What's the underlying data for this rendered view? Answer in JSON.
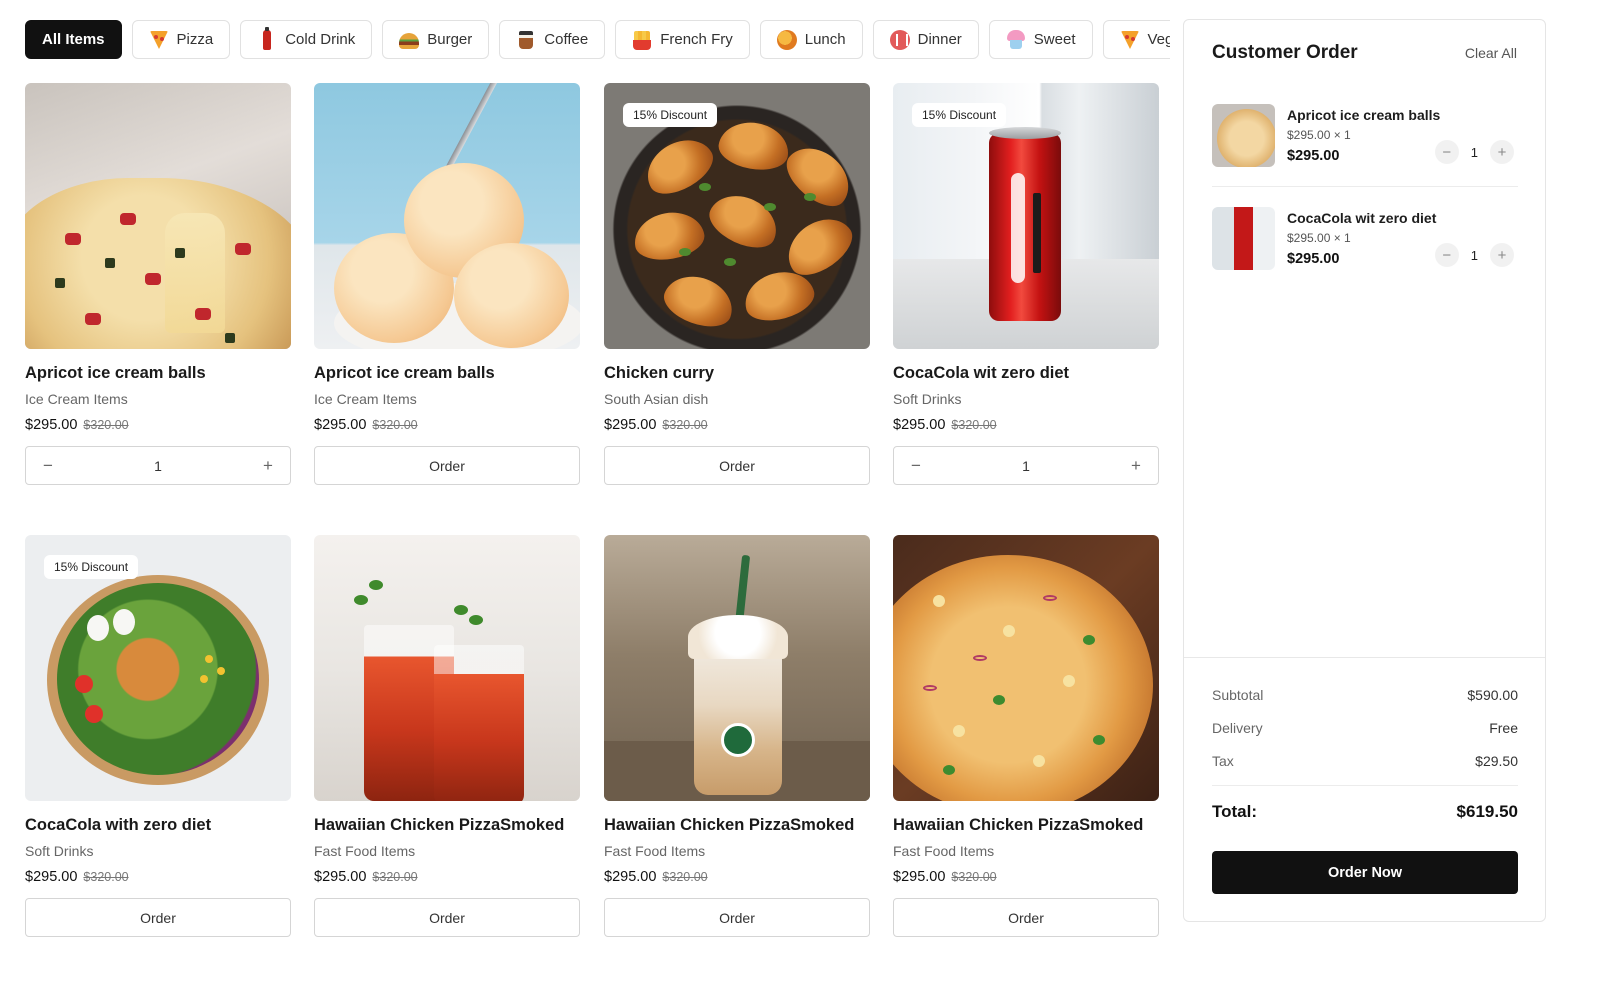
{
  "categories": [
    {
      "label": "All Items",
      "icon": "",
      "active": true
    },
    {
      "label": "Pizza",
      "icon": "pizza-icon"
    },
    {
      "label": "Cold Drink",
      "icon": "cold-drink-icon"
    },
    {
      "label": "Burger",
      "icon": "burger-icon"
    },
    {
      "label": "Coffee",
      "icon": "coffee-icon"
    },
    {
      "label": "French Fry",
      "icon": "french-fry-icon"
    },
    {
      "label": "Lunch",
      "icon": "lunch-icon"
    },
    {
      "label": "Dinner",
      "icon": "dinner-icon"
    },
    {
      "label": "Sweet",
      "icon": "sweet-icon"
    },
    {
      "label": "Veg",
      "icon": "veg-icon"
    }
  ],
  "products": [
    {
      "name": "Apricot ice cream balls",
      "category": "Ice Cream Items",
      "price": "$295.00",
      "old_price": "$320.00",
      "badge": "",
      "action": "stepper",
      "qty": "1",
      "image": "pizza-slice-image"
    },
    {
      "name": "Apricot ice cream balls",
      "category": "Ice Cream Items",
      "price": "$295.00",
      "old_price": "$320.00",
      "badge": "",
      "action": "order",
      "button_label": "Order",
      "image": "ice-cream-image"
    },
    {
      "name": "Chicken curry",
      "category": "South Asian dish",
      "price": "$295.00",
      "old_price": "$320.00",
      "badge": "15% Discount",
      "action": "order",
      "button_label": "Order",
      "image": "chicken-image"
    },
    {
      "name": "CocaCola wit zero diet",
      "category": "Soft Drinks",
      "price": "$295.00",
      "old_price": "$320.00",
      "badge": "15% Discount",
      "action": "stepper",
      "qty": "1",
      "image": "coke-can-image"
    },
    {
      "name": "CocaCola with zero diet",
      "category": "Soft Drinks",
      "price": "$295.00",
      "old_price": "$320.00",
      "badge": "15% Discount",
      "action": "order",
      "button_label": "Order",
      "image": "salad-bowl-image"
    },
    {
      "name": "Hawaiian Chicken PizzaSmoked",
      "category": "Fast Food Items",
      "price": "$295.00",
      "old_price": "$320.00",
      "badge": "",
      "action": "order",
      "button_label": "Order",
      "image": "iced-tea-image"
    },
    {
      "name": "Hawaiian Chicken PizzaSmoked",
      "category": "Fast Food Items",
      "price": "$295.00",
      "old_price": "$320.00",
      "badge": "",
      "action": "order",
      "button_label": "Order",
      "image": "frappuccino-image"
    },
    {
      "name": "Hawaiian Chicken PizzaSmoked",
      "category": "Fast Food Items",
      "price": "$295.00",
      "old_price": "$320.00",
      "badge": "",
      "action": "order",
      "button_label": "Order",
      "image": "pizza-board-image"
    }
  ],
  "order": {
    "title": "Customer Order",
    "clear_label": "Clear All",
    "items": [
      {
        "name": "Apricot ice cream balls",
        "unit": "$295.00 × 1",
        "price": "$295.00",
        "qty": "1"
      },
      {
        "name": "CocaCola wit zero diet",
        "unit": "$295.00 × 1",
        "price": "$295.00",
        "qty": "1"
      }
    ],
    "summary": {
      "subtotal_label": "Subtotal",
      "subtotal": "$590.00",
      "delivery_label": "Delivery",
      "delivery": "Free",
      "tax_label": "Tax",
      "tax": "$29.50",
      "total_label": "Total:",
      "total": "$619.50"
    },
    "order_now_label": "Order Now"
  }
}
